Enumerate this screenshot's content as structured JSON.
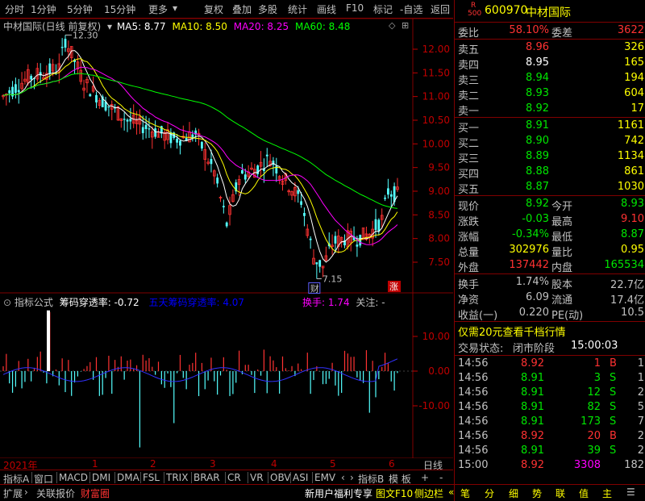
{
  "toolbar": {
    "tabs": [
      "分时",
      "1分钟",
      "5分钟",
      "15分钟",
      "更多",
      "复权",
      "叠加",
      "多股",
      "统计",
      "画线",
      "F10",
      "标记",
      "-自选",
      "返回"
    ]
  },
  "chart": {
    "title": "中材国际(日线 前复权)",
    "ma": [
      {
        "label": "MA5: 8.77",
        "color": "#ffffff"
      },
      {
        "label": "MA10: 8.50",
        "color": "#ffff00"
      },
      {
        "label": "MA20: 8.25",
        "color": "#ff00ff"
      },
      {
        "label": "MA60: 8.48",
        "color": "#00ff00"
      }
    ],
    "high_label": "12.30",
    "low_label": "7.15",
    "price_axis": [
      "12.00",
      "11.50",
      "11.00",
      "10.50",
      "10.00",
      "9.50",
      "9.00",
      "8.50",
      "8.00",
      "7.50"
    ],
    "badge_cai": "财",
    "badge_zhang": "涨"
  },
  "indicator": {
    "label": "指标公式",
    "name": "筹码穿透率: -0.72",
    "sub": "五天筹码穿透率: 4.07",
    "huanshou": "换手: 1.74",
    "guanzhu": "关注: -",
    "axis": [
      "10.00",
      "0.00",
      "-10.00"
    ]
  },
  "date_axis": {
    "year": "2021年",
    "months": [
      "1",
      "2",
      "3",
      "4",
      "5",
      "6"
    ],
    "period": "日线"
  },
  "bottom_tabs": [
    "指标A",
    "窗口",
    "MACD",
    "DMI",
    "DMA",
    "FSL",
    "TRIX",
    "BRAR",
    "CR",
    "VR",
    "OBV",
    "ASI",
    "EMV"
  ],
  "bottom_right_tabs": [
    "指标B",
    "模 板",
    "+",
    "-"
  ],
  "bottom_bar2_left": [
    "扩展",
    "关联报价",
    "财富圈"
  ],
  "bottom_bar2_right": [
    "新用户福利专享",
    "图文F10",
    "侧边栏"
  ],
  "bottom_icons": [
    "笔",
    "分",
    "细",
    "势",
    "联",
    "值",
    "主"
  ],
  "quote": {
    "r_label": "R",
    "r_num": "500",
    "code": "600970",
    "name": "中材国际",
    "weibi_label": "委比",
    "weibi": "58.10%",
    "weicha_label": "委差",
    "weicha": "3622",
    "sells": [
      {
        "label": "卖五",
        "price": "8.96",
        "vol": "326"
      },
      {
        "label": "卖四",
        "price": "8.95",
        "vol": "165"
      },
      {
        "label": "卖三",
        "price": "8.94",
        "vol": "194"
      },
      {
        "label": "卖二",
        "price": "8.93",
        "vol": "604"
      },
      {
        "label": "卖一",
        "price": "8.92",
        "vol": "17"
      }
    ],
    "buys": [
      {
        "label": "买一",
        "price": "8.91",
        "vol": "1161"
      },
      {
        "label": "买二",
        "price": "8.90",
        "vol": "742"
      },
      {
        "label": "买三",
        "price": "8.89",
        "vol": "1134"
      },
      {
        "label": "买四",
        "price": "8.88",
        "vol": "861"
      },
      {
        "label": "买五",
        "price": "8.87",
        "vol": "1030"
      }
    ],
    "stats": [
      {
        "l1": "现价",
        "v1": "8.92",
        "l2": "今开",
        "v2": "8.93"
      },
      {
        "l1": "涨跌",
        "v1": "-0.03",
        "l2": "最高",
        "v2": "9.10"
      },
      {
        "l1": "涨幅",
        "v1": "-0.34%",
        "l2": "最低",
        "v2": "8.87"
      },
      {
        "l1": "总量",
        "v1": "302976",
        "l2": "量比",
        "v2": "0.95"
      },
      {
        "l1": "外盘",
        "v1": "137442",
        "l2": "内盘",
        "v2": "165534"
      }
    ],
    "stats2": [
      {
        "l1": "换手",
        "v1": "1.74%",
        "l2": "股本",
        "v2": "22.7亿"
      },
      {
        "l1": "净资",
        "v1": "6.09",
        "l2": "流通",
        "v2": "17.4亿"
      },
      {
        "l1": "收益(一)",
        "v1": "0.220",
        "l2": "PE(动)",
        "v2": "10.5"
      }
    ],
    "promo": "仅需20元查看千档行情",
    "status_label": "交易状态:",
    "status_value": "闭市阶段",
    "status_time": "15:00:03",
    "ticks": [
      {
        "t": "14:56",
        "p": "8.92",
        "v": "1",
        "s": "B",
        "n": "1"
      },
      {
        "t": "14:56",
        "p": "8.91",
        "v": "3",
        "s": "S",
        "n": "1"
      },
      {
        "t": "14:56",
        "p": "8.91",
        "v": "12",
        "s": "S",
        "n": "2"
      },
      {
        "t": "14:56",
        "p": "8.91",
        "v": "82",
        "s": "S",
        "n": "5"
      },
      {
        "t": "14:56",
        "p": "8.91",
        "v": "173",
        "s": "S",
        "n": "7"
      },
      {
        "t": "14:56",
        "p": "8.92",
        "v": "20",
        "s": "B",
        "n": "2"
      },
      {
        "t": "14:56",
        "p": "8.91",
        "v": "39",
        "s": "S",
        "n": "2"
      },
      {
        "t": "15:00",
        "p": "8.92",
        "v": "3308",
        "s": "",
        "n": "182"
      }
    ]
  }
}
